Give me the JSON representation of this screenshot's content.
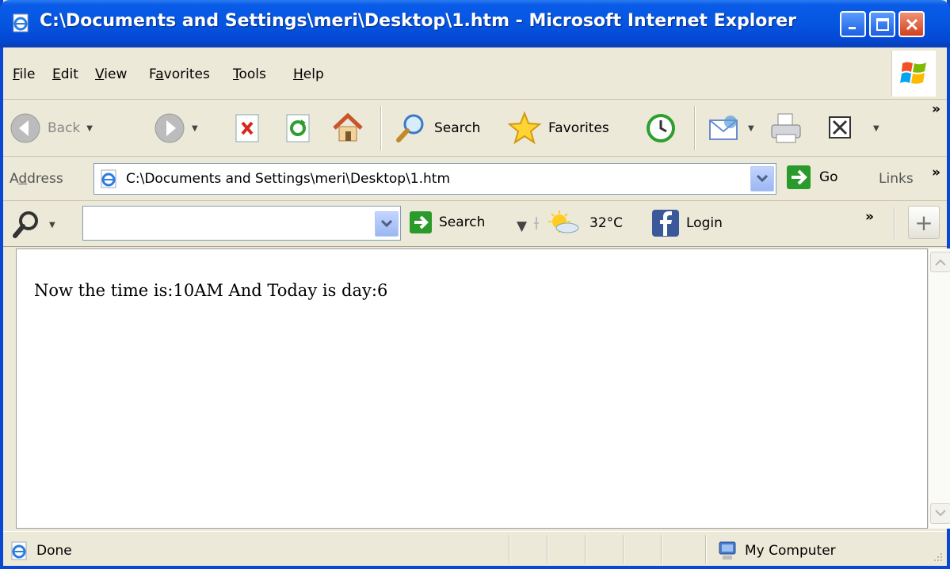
{
  "window": {
    "title": "C:\\Documents and Settings\\meri\\Desktop\\1.htm - Microsoft Internet Explorer"
  },
  "menu": {
    "items": [
      {
        "ul": "F",
        "rest": "ile"
      },
      {
        "ul": "E",
        "rest": "dit"
      },
      {
        "ul": "V",
        "rest": "iew"
      },
      {
        "pre": "F",
        "ul": "a",
        "rest": "vorites"
      },
      {
        "ul": "T",
        "rest": "ools"
      },
      {
        "ul": "H",
        "rest": "elp"
      }
    ]
  },
  "toolbar": {
    "back_label": "Back",
    "search_label": "Search",
    "favorites_label": "Favorites",
    "overflow": "»"
  },
  "address": {
    "label_pre": "A",
    "label_ul": "d",
    "label_rest": "dress",
    "url": "C:\\Documents and Settings\\meri\\Desktop\\1.htm",
    "go_label": "Go",
    "links_label": "Links",
    "links_overflow": "»"
  },
  "searchbar": {
    "input_value": "",
    "search_label": "Search",
    "weather": "32°C",
    "login_label": "Login",
    "overflow": "»",
    "plus": "+"
  },
  "page": {
    "text": "Now the time is:10AM And Today is day:6"
  },
  "status": {
    "text": "Done",
    "zone": "My Computer"
  },
  "colors": {
    "titlebar": "#0555e0",
    "chrome": "#ece9d8",
    "go_green": "#2a9a2a"
  },
  "icons": [
    "ie-page-icon",
    "minimize-icon",
    "maximize-icon",
    "close-icon",
    "windows-logo-icon",
    "back-arrow-icon",
    "forward-arrow-icon",
    "stop-icon",
    "refresh-icon",
    "home-icon",
    "search-magnifier-icon",
    "favorites-star-icon",
    "history-icon",
    "mail-icon",
    "print-icon",
    "edit-icon",
    "go-arrow-icon",
    "weather-icon",
    "facebook-icon",
    "computer-icon"
  ]
}
